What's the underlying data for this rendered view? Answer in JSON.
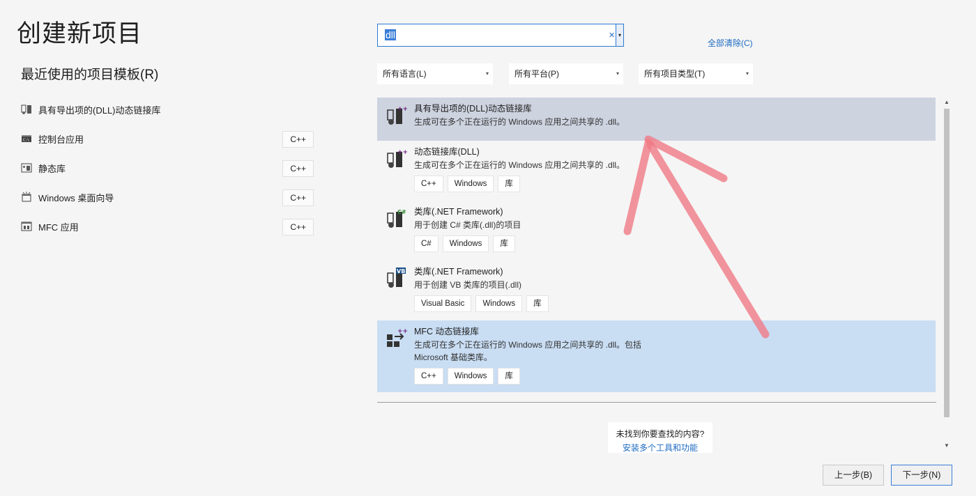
{
  "page_title": "创建新项目",
  "recent": {
    "title": "最近使用的项目模板(R)",
    "items": [
      {
        "label": "具有导出项的(DLL)动态链接库",
        "tag": "",
        "icon": "dll-export-icon"
      },
      {
        "label": "控制台应用",
        "tag": "C++",
        "icon": "console-app-icon"
      },
      {
        "label": "静态库",
        "tag": "C++",
        "icon": "static-lib-icon"
      },
      {
        "label": "Windows 桌面向导",
        "tag": "C++",
        "icon": "desktop-wizard-icon"
      },
      {
        "label": "MFC 应用",
        "tag": "C++",
        "icon": "mfc-app-icon"
      }
    ]
  },
  "search": {
    "value": "dll",
    "clear_symbol": "×",
    "dropdown_symbol": "▾"
  },
  "clear_all": "全部清除(C)",
  "filters": {
    "language": "所有语言(L)",
    "platform": "所有平台(P)",
    "project_type": "所有项目类型(T)",
    "arrow": "▾"
  },
  "results": [
    {
      "name": "具有导出项的(DLL)动态链接库",
      "desc1": "生成可在多个正在运行的 Windows 应用之间共享的 .dll。",
      "desc2": "",
      "tags": [],
      "badge": "++"
    },
    {
      "name": "动态链接库(DLL)",
      "desc1": "生成可在多个正在运行的 Windows 应用之间共享的 .dll。",
      "desc2": "",
      "tags": [
        "C++",
        "Windows",
        "库"
      ],
      "badge": "++"
    },
    {
      "name": "类库(.NET Framework)",
      "desc1": "用于创建 C# 类库(.dll)的项目",
      "desc2": "",
      "tags": [
        "C#",
        "Windows",
        "库"
      ],
      "badge": "C#"
    },
    {
      "name": "类库(.NET Framework)",
      "desc1": "用于创建 VB 类库的项目(.dll)",
      "desc2": "",
      "tags": [
        "Visual Basic",
        "Windows",
        "库"
      ],
      "badge": "VB"
    },
    {
      "name": "MFC 动态链接库",
      "desc1": "生成可在多个正在运行的 Windows 应用之间共享的 .dll。包括",
      "desc2": "Microsoft 基础类库。",
      "tags": [
        "C++",
        "Windows",
        "库"
      ],
      "badge": "++"
    }
  ],
  "not_found": {
    "question": "未找到你要查找的内容?",
    "link": "安装多个工具和功能"
  },
  "buttons": {
    "back": "上一步(B)",
    "next": "下一步(N)"
  },
  "scroll": {
    "up": "▲",
    "down": "▼"
  },
  "colors": {
    "accent": "#1c6ac2",
    "hover": "#cdd3df",
    "selected": "#c9ddf3",
    "annotation_arrow": "#f07a86"
  }
}
